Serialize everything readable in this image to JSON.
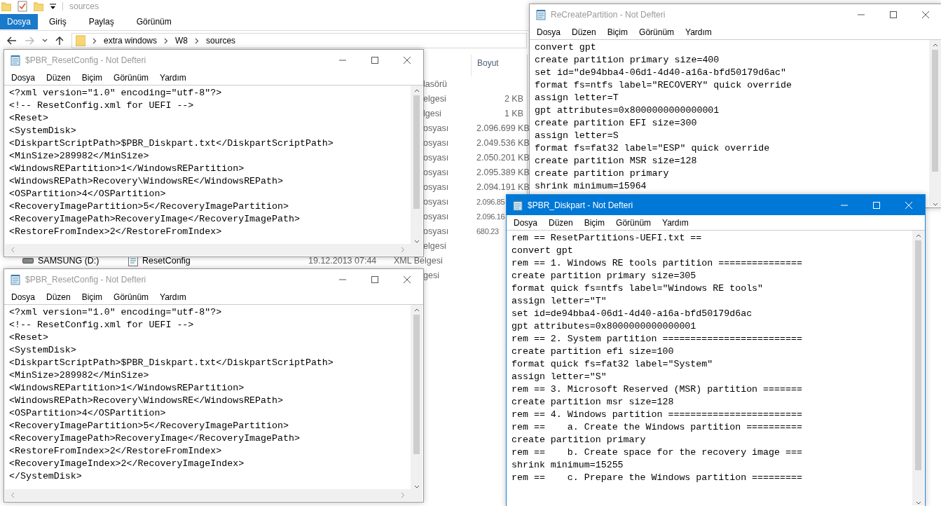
{
  "explorer": {
    "title": "sources",
    "tabs": [
      {
        "label": "Dosya",
        "selected": true
      },
      {
        "label": "Giriş",
        "selected": false
      },
      {
        "label": "Paylaş",
        "selected": false
      },
      {
        "label": "Görünüm",
        "selected": false
      }
    ],
    "breadcrumb": [
      "extra windows",
      "W8",
      "sources"
    ],
    "column": "Boyut",
    "rows": [
      {
        "type": "lasörü"
      },
      {
        "type": "elgesi",
        "size": "2 KB"
      },
      {
        "type": "lgesi",
        "size": "1 KB"
      },
      {
        "type": "osyası",
        "size": "2.096.699 KB"
      },
      {
        "type": "osyası",
        "size": "2.049.536 KB"
      },
      {
        "type": "osyası",
        "size": "2.050.201 KB"
      },
      {
        "type": "osyası",
        "size": "2.095.389 KB"
      },
      {
        "type": "osyası",
        "size": "2.094.191 KB"
      },
      {
        "type": "osyası",
        "size": "2.096.85",
        "kind": "cut"
      },
      {
        "type": "osyası",
        "size": "2.096.16",
        "kind": "cut"
      },
      {
        "type": "osyası",
        "size": "680.23",
        "kind": "cut"
      },
      {
        "type": "elgesi"
      },
      {
        "nav": "SAMSUNG (D:)",
        "name": "ResetConfig",
        "date": "19.12.2013 07:44",
        "type": "XML Belgesi"
      },
      {
        "type": "gesi"
      }
    ]
  },
  "windows": [
    {
      "title": "$PBR_ResetConfig - Not Defteri",
      "active": false,
      "menu": [
        "Dosya",
        "Düzen",
        "Biçim",
        "Görünüm",
        "Yardım"
      ],
      "lines": [
        "<?xml version=\"1.0\" encoding=\"utf-8\"?>",
        "<!-- ResetConfig.xml for UEFI -->",
        "<Reset>",
        "<SystemDisk>",
        "<DiskpartScriptPath>$PBR_Diskpart.txt</DiskpartScriptPath>",
        "<MinSize>289982</MinSize>",
        "<WindowsREPartition>1</WindowsREPartition>",
        "<WindowsREPath>Recovery\\WindowsRE</WindowsREPath>",
        "<OSPartition>4</OSPartition>",
        "<RecoveryImagePartition>5</RecoveryImagePartition>",
        "<RecoveryImagePath>RecoveryImage</RecoveryImagePath>",
        "<RestoreFromIndex>2</RestoreFromIndex>"
      ]
    },
    {
      "title": "$PBR_ResetConfig - Not Defteri",
      "active": false,
      "menu": [
        "Dosya",
        "Düzen",
        "Biçim",
        "Görünüm",
        "Yardım"
      ],
      "lines": [
        "<?xml version=\"1.0\" encoding=\"utf-8\"?>",
        "<!-- ResetConfig.xml for UEFI -->",
        "<Reset>",
        "<SystemDisk>",
        "<DiskpartScriptPath>$PBR_Diskpart.txt</DiskpartScriptPath>",
        "<MinSize>289982</MinSize>",
        "<WindowsREPartition>1</WindowsREPartition>",
        "<WindowsREPath>Recovery\\WindowsRE</WindowsREPath>",
        "<OSPartition>4</OSPartition>",
        "<RecoveryImagePartition>5</RecoveryImagePartition>",
        "<RecoveryImagePath>RecoveryImage</RecoveryImagePath>",
        "<RestoreFromIndex>2</RestoreFromIndex>",
        "<RecoveryImageIndex>2</RecoveryImageIndex>",
        "</SystemDisk>"
      ]
    },
    {
      "title": "ReCreatePartition - Not Defteri",
      "active": false,
      "menu": [
        "Dosya",
        "Düzen",
        "Biçim",
        "Görünüm",
        "Yardım"
      ],
      "lines": [
        "convert gpt",
        "create partition primary size=400",
        "set id=\"de94bba4-06d1-4d40-a16a-bfd50179d6ac\"",
        "format fs=ntfs label=\"RECOVERY\" quick override",
        "assign letter=T",
        "gpt attributes=0x8000000000000001",
        "create partition EFI size=300",
        "assign letter=S",
        "format fs=fat32 label=\"ESP\" quick override",
        "create partition MSR size=128",
        "create partition primary",
        "shrink minimum=15964"
      ]
    },
    {
      "title": "$PBR_Diskpart - Not Defteri",
      "active": true,
      "menu": [
        "Dosya",
        "Düzen",
        "Biçim",
        "Görünüm",
        "Yardım"
      ],
      "lines": [
        "rem == ResetPartitions-UEFI.txt ==",
        "convert gpt",
        "rem == 1. Windows RE tools partition ===============",
        "create partition primary size=305",
        "format quick fs=ntfs label=\"Windows RE tools\"",
        "assign letter=\"T\"",
        "set id=de94bba4-06d1-4d40-a16a-bfd50179d6ac",
        "gpt attributes=0x8000000000000001",
        "rem == 2. System partition =========================",
        "create partition efi size=100",
        "format quick fs=fat32 label=\"System\"",
        "assign letter=\"S\"",
        "rem == 3. Microsoft Reserved (MSR) partition =======",
        "create partition msr size=128",
        "rem == 4. Windows partition ========================",
        "rem ==    a. Create the Windows partition ==========",
        "create partition primary",
        "rem ==    b. Create space for the recovery image ===",
        "shrink minimum=15255",
        "rem ==    c. Prepare the Windows partition ========="
      ]
    }
  ]
}
